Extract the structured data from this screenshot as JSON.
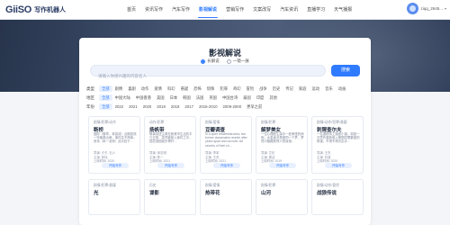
{
  "nav": {
    "logo_mark": "GiiSO",
    "logo_text": "写作机器人",
    "items": [
      {
        "label": "首页",
        "active": false
      },
      {
        "label": "资讯写作",
        "active": false
      },
      {
        "label": "汽车写作",
        "active": false
      },
      {
        "label": "影视解说",
        "active": true
      },
      {
        "label": "营销写作",
        "active": false
      },
      {
        "label": "文案改写",
        "active": false
      },
      {
        "label": "汽车资讯",
        "active": false
      },
      {
        "label": "直播学习",
        "active": false
      },
      {
        "label": "天气播报",
        "active": false
      }
    ],
    "user_name": "ziqq_2645...",
    "user_caret": "▾"
  },
  "panel": {
    "title": "影视解说",
    "modes": [
      {
        "label": "长解说",
        "selected": true
      },
      {
        "label": "一镜一展",
        "selected": false
      }
    ],
    "search_placeholder": "请输入你感兴趣的内容名人",
    "search_button": "搜索"
  },
  "filters": [
    {
      "label": "类型",
      "options": [
        "全部",
        "剧情",
        "喜剧",
        "动作",
        "爱情",
        "科幻",
        "悬疑",
        "恐怖",
        "惊悚",
        "犯罪",
        "奇幻",
        "冒险",
        "战争",
        "历史",
        "传记",
        "家庭",
        "运动",
        "音乐",
        "动画"
      ],
      "selected": 0
    },
    {
      "label": "地区",
      "options": [
        "全部",
        "中国大陆",
        "中国香港",
        "美国",
        "日本",
        "韩国",
        "法国",
        "英国",
        "中国台湾",
        "泰国",
        "印度",
        "其他"
      ],
      "selected": 0
    },
    {
      "label": "年份",
      "options": [
        "全部",
        "2022",
        "2021",
        "2020",
        "2019",
        "2018",
        "2017",
        "2016-2010",
        "2009-2000",
        "更早之前"
      ],
      "selected": 0
    }
  ],
  "cards_top": [
    {
      "genre": "剧情/犯罪/动作",
      "title": "断桥",
      "desc": "国际（徽章、林嘉成）近期发现一宗离奇凶案，事件并不简单。张伟（朱一龙饰）此次处于…",
      "meta": [
        "导演: 夕夕, 石人",
        "主演: 张伟",
        "上映时间: 2020"
      ],
      "button": "开始写作"
    },
    {
      "genre": "动作/犯罪",
      "title": "扬帆带",
      "desc": "故事讲述主角在新港市生活的平凡日常，突然被卷入案件之中，层层谜团逐步揭开…",
      "meta": [
        "导演: 邱志明",
        "主演: 陈一",
        "上映时间: 2021"
      ],
      "button": "开始写作"
    },
    {
      "genre": "剧情/爱情",
      "title": "豆瓣调查",
      "desc": "In a quiet residential area, two former classmates reunite after years apart and uncover old secrets of their ch...",
      "meta": [
        "导演: 李军",
        "主演: 王芳",
        "上映时间: 2021"
      ],
      "button": "开始写作"
    },
    {
      "genre": "剧情/犯罪",
      "title": "解梦美女",
      "desc": "一位心理医生接手一桩奇怪的病例，女患者总是做同一个梦，梦境中隐藏着惊人的真相…",
      "meta": [
        "导演: 艾伦",
        "主演: 周洁",
        "上映时间: 2019"
      ],
      "button": "开始写作"
    },
    {
      "genre": "剧情/动作/犯罪/悬疑",
      "title": "刺猬查尔夫",
      "desc": "一名退役特工隐居小镇，却因一次意外重新卷入跨国犯罪集团的阴谋，不得不再次出手…",
      "meta": [
        "导演: 王杰",
        "主演: 刘强",
        "上映时间: 2020"
      ],
      "button": "开始写作"
    }
  ],
  "cards_bottom": [
    {
      "genre": "剧情/犯罪/悬疑",
      "title": "光"
    },
    {
      "genre": "历史",
      "title": "谍影"
    },
    {
      "genre": "剧情/爱情",
      "title": "热带花"
    },
    {
      "genre": "剧情/犯罪",
      "title": "山河"
    },
    {
      "genre": "剧情/动作/冒险",
      "title": "战狼传说"
    }
  ]
}
